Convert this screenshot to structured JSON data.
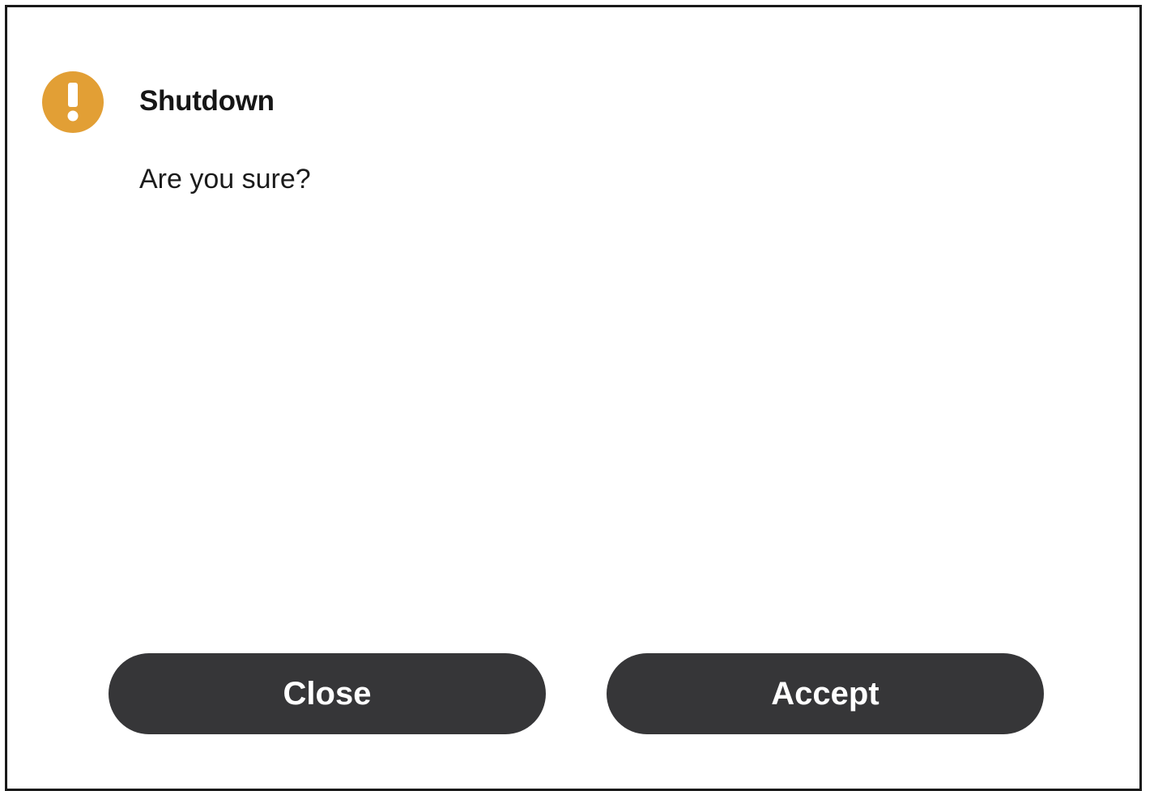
{
  "dialog": {
    "title": "Shutdown",
    "message": "Are you sure?",
    "icon": "warning-exclamation-icon",
    "warning_color": "#e29f35"
  },
  "buttons": {
    "close_label": "Close",
    "accept_label": "Accept",
    "background_color": "#363638"
  }
}
